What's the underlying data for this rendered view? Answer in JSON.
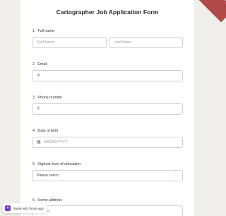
{
  "form": {
    "title": "Cartographer Job Application Form",
    "q1": {
      "number": "1.",
      "label": "Full name",
      "first_placeholder": "First Name",
      "last_placeholder": "Last Name"
    },
    "q2": {
      "number": "2.",
      "label": "Email"
    },
    "q3": {
      "number": "3.",
      "label": "Phone number"
    },
    "q4": {
      "number": "4.",
      "label": "Date of birth",
      "placeholder": "MM/DD/YYYY"
    },
    "q5": {
      "number": "5.",
      "label": "Highest level of education",
      "selected": "Please select"
    },
    "q6": {
      "number": "6.",
      "label": "Home address",
      "placeholder": "Address"
    }
  },
  "badge": {
    "text": "Made with forms.app",
    "logo": "forms-app-logo"
  },
  "icons": {
    "email": "mail-icon",
    "phone": "phone-icon",
    "date": "calendar-icon",
    "select": "chevron-down-icon"
  },
  "colors": {
    "page_bg": "#f0eeea",
    "card_bg": "#ffffff",
    "ribbon": "#b04a4a",
    "badge_logo": "#6b3fc9"
  }
}
